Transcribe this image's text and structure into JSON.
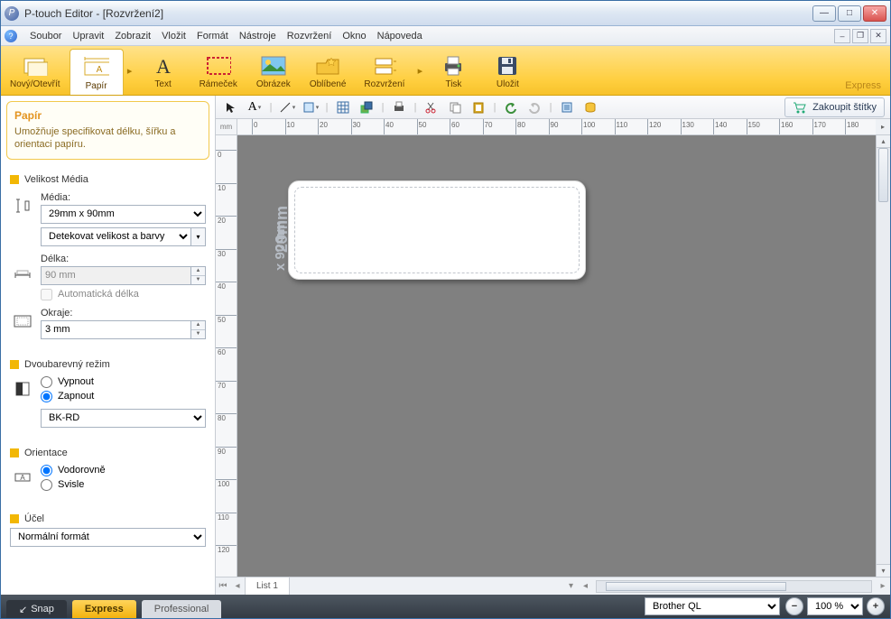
{
  "window": {
    "title": "P-touch Editor - [Rozvržení2]"
  },
  "menu": {
    "items": [
      "Soubor",
      "Upravit",
      "Zobrazit",
      "Vložit",
      "Formát",
      "Nástroje",
      "Rozvržení",
      "Okno",
      "Nápoveda"
    ]
  },
  "ribbon": {
    "items": [
      {
        "label": "Nový/Otevřít",
        "name": "ribbon-new-open"
      },
      {
        "label": "Papír",
        "name": "ribbon-paper",
        "active": true
      },
      {
        "label": "Text",
        "name": "ribbon-text"
      },
      {
        "label": "Rámeček",
        "name": "ribbon-frame"
      },
      {
        "label": "Obrázek",
        "name": "ribbon-image"
      },
      {
        "label": "Oblíbené",
        "name": "ribbon-favorites"
      },
      {
        "label": "Rozvržení",
        "name": "ribbon-layout"
      },
      {
        "label": "Tisk",
        "name": "ribbon-print"
      },
      {
        "label": "Uložit",
        "name": "ribbon-save"
      }
    ],
    "mode_label": "Express"
  },
  "buy_button": "Zakoupit štítky",
  "panel": {
    "title": "Papír",
    "description": "Umožňuje specifikovat délku, šířku a orientaci papíru.",
    "media_size_header": "Velikost Média",
    "media_label": "Média:",
    "media_value": "29mm x 90mm",
    "detect_value": "Detekovat velikost a barvy",
    "length_label": "Délka:",
    "length_value": "90 mm",
    "auto_length_label": "Automatická délka",
    "margins_label": "Okraje:",
    "margins_value": "3 mm",
    "twocolor_header": "Dvoubarevný režim",
    "twocolor_off": "Vypnout",
    "twocolor_on": "Zapnout",
    "color_value": "BK-RD",
    "orientation_header": "Orientace",
    "orientation_h": "Vodorovně",
    "orientation_v": "Svisle",
    "purpose_header": "Účel",
    "purpose_value": "Normální formát"
  },
  "canvas": {
    "unit": "mm",
    "label_dim_primary": "29mm",
    "label_dim_secondary": "x 90mm",
    "sheet_tab": "List 1"
  },
  "status": {
    "mode_snap": "Snap",
    "mode_express": "Express",
    "mode_pro": "Professional",
    "printer": "Brother QL",
    "zoom": "100 %"
  }
}
